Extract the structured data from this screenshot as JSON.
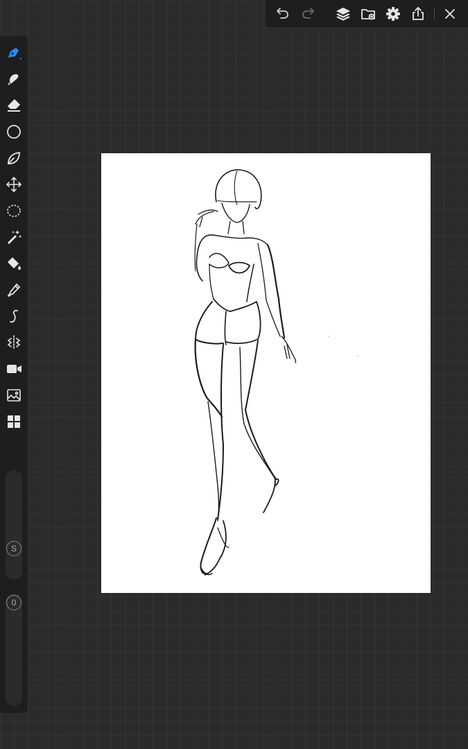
{
  "toolbar": {
    "icons": [
      "undo-icon",
      "redo-icon",
      "layers-icon",
      "gallery-icon",
      "settings-icon",
      "export-icon",
      "close-icon"
    ]
  },
  "tools": [
    {
      "name": "brush",
      "icon": "brush-icon",
      "active": true
    },
    {
      "name": "smudge",
      "icon": "smudge-icon"
    },
    {
      "name": "eraser",
      "icon": "eraser-icon"
    },
    {
      "name": "shape",
      "icon": "shape-icon"
    },
    {
      "name": "fill-lasso",
      "icon": "fill-lasso-icon"
    },
    {
      "name": "transform",
      "icon": "transform-icon"
    },
    {
      "name": "lasso-select",
      "icon": "lasso-select-icon"
    },
    {
      "name": "magic-wand",
      "icon": "magic-wand-icon"
    },
    {
      "name": "paint-bucket",
      "icon": "paint-bucket-icon"
    },
    {
      "name": "eyedropper",
      "icon": "eyedropper-icon"
    },
    {
      "name": "stroke",
      "icon": "stroke-icon"
    },
    {
      "name": "symmetry",
      "icon": "symmetry-icon"
    },
    {
      "name": "record",
      "icon": "video-icon"
    },
    {
      "name": "import-image",
      "icon": "image-icon"
    },
    {
      "name": "more",
      "icon": "grid-icon"
    }
  ],
  "sliders": {
    "size_label": "S",
    "opacity_label": "0"
  },
  "colors": {
    "accent": "#1e90ff",
    "panel": "#1e1e1e",
    "background": "#2b2b2b",
    "icon": "#e6e6e6",
    "paper": "#ffffff",
    "sketch": "#1a1a1a"
  }
}
